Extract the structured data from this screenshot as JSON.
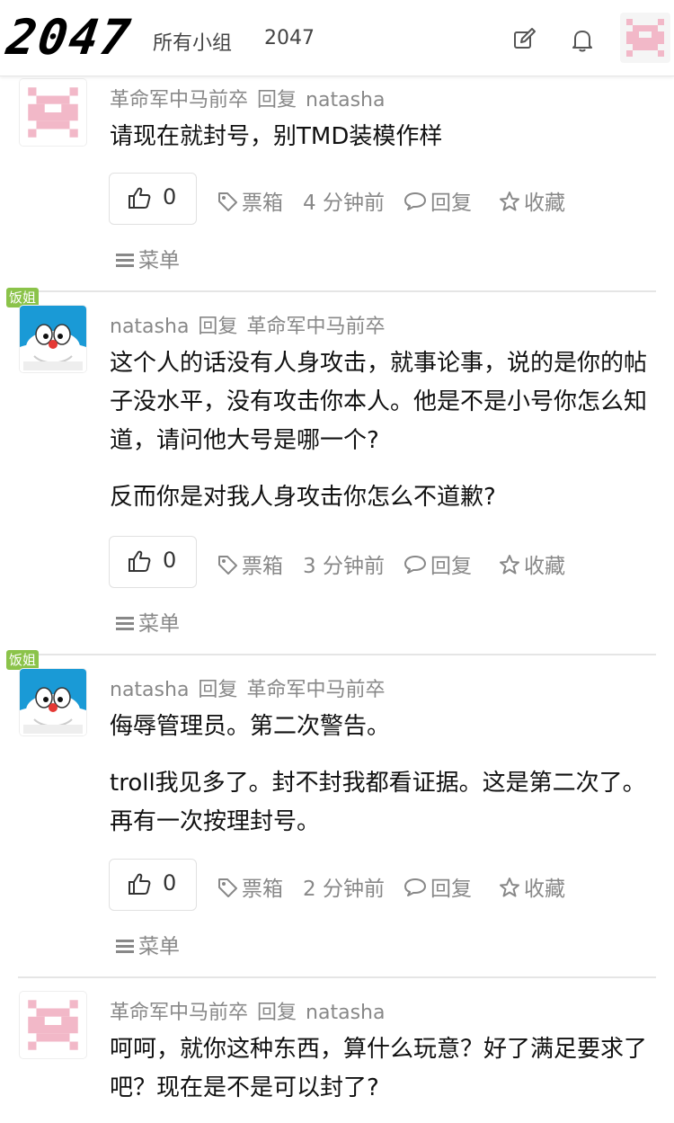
{
  "header": {
    "logo": "2047",
    "nav_groups": "所有小组",
    "nav_home": "2047"
  },
  "comments": [
    {
      "author": "革命军中马前卒",
      "reply_word": "回复",
      "reply_to": "natasha",
      "paragraphs": [
        "请现在就封号，别TMD装模作样"
      ],
      "likes": "0",
      "ticket": "票箱",
      "time": "4 分钟前",
      "reply_btn": "回复",
      "fav": "收藏",
      "menu": "菜单"
    },
    {
      "badge": "饭姐",
      "author": "natasha",
      "reply_word": "回复",
      "reply_to": "革命军中马前卒",
      "paragraphs": [
        "这个人的话没有人身攻击，就事论事，说的是你的帖子没水平，没有攻击你本人。他是不是小号你怎么知道，请问他大号是哪一个?",
        "反而你是对我人身攻击你怎么不道歉?"
      ],
      "likes": "0",
      "ticket": "票箱",
      "time": "3 分钟前",
      "reply_btn": "回复",
      "fav": "收藏",
      "menu": "菜单"
    },
    {
      "badge": "饭姐",
      "author": "natasha",
      "reply_word": "回复",
      "reply_to": "革命军中马前卒",
      "paragraphs": [
        "侮辱管理员。第二次警告。",
        "troll我见多了。封不封我都看证据。这是第二次了。再有一次按理封号。"
      ],
      "likes": "0",
      "ticket": "票箱",
      "time": "2 分钟前",
      "reply_btn": "回复",
      "fav": "收藏",
      "menu": "菜单"
    },
    {
      "author": "革命军中马前卒",
      "reply_word": "回复",
      "reply_to": "natasha",
      "paragraphs": [
        "呵呵，就你这种东西，算什么玩意？好了满足要求了吧？现在是不是可以封了?"
      ]
    }
  ],
  "icons": {
    "edit": "edit-icon",
    "bell": "bell-icon",
    "thumb": "thumbs-up-icon",
    "tag": "tag-icon",
    "chat": "chat-bubble-icon",
    "star": "star-icon",
    "menu": "hamburger-icon"
  },
  "colors": {
    "badge_green": "#8bc34a",
    "avatar_pink": "#f2b8c8",
    "meta_gray": "#888888",
    "divider": "#e5e5e5"
  }
}
